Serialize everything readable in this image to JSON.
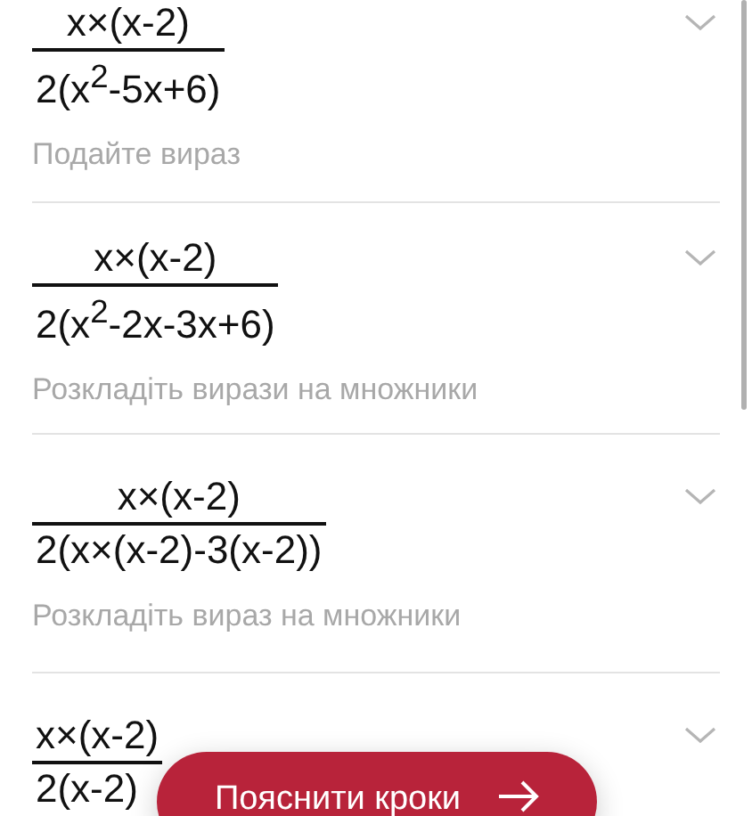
{
  "steps": [
    {
      "numerator": "x×(x-2)",
      "denominator": "2(x$^{2}$-5x+6)",
      "hint": "Подайте вираз",
      "expanded": false
    },
    {
      "numerator": "x×(x-2)",
      "denominator": "2(x$^{2}$-2x-3x+6)",
      "hint": "Розкладіть вирази на множники",
      "expanded": false
    },
    {
      "numerator": "x×(x-2)",
      "denominator": "2(x×(x-2)-3(x-2))",
      "hint": "Розкладіть вираз на множники",
      "expanded": false
    },
    {
      "numerator": "x×(x-2)",
      "denominator": "2(x-2)",
      "expanded": false
    }
  ],
  "action_button": {
    "label": "Пояснити кроки"
  }
}
